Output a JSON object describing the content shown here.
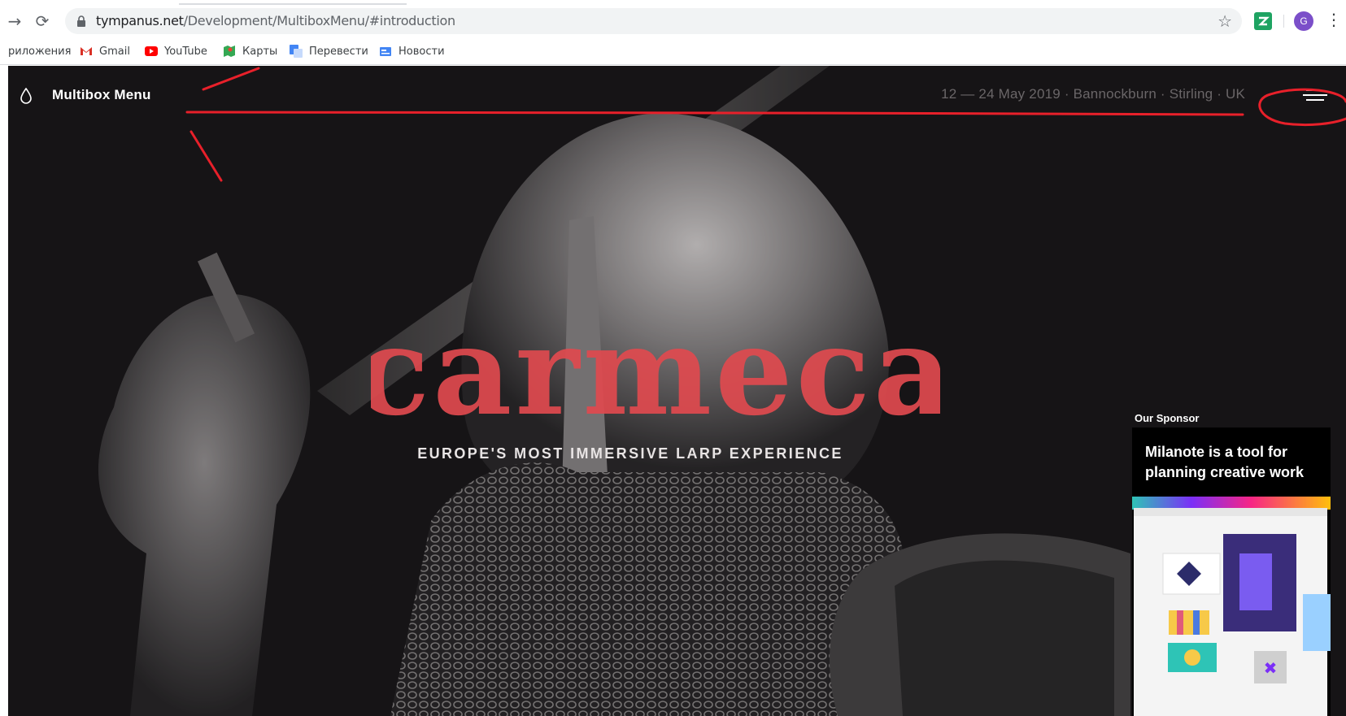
{
  "browser": {
    "url_host": "tympanus.net",
    "url_path": "/Development/MultiboxMenu/#introduction",
    "profile_initial": "G",
    "bookmarks": [
      {
        "label": "риложения",
        "icon": "apps-icon"
      },
      {
        "label": "Gmail",
        "icon": "gmail-icon"
      },
      {
        "label": "YouTube",
        "icon": "youtube-icon"
      },
      {
        "label": "Карты",
        "icon": "maps-icon"
      },
      {
        "label": "Перевести",
        "icon": "translate-icon"
      },
      {
        "label": "Новости",
        "icon": "news-icon"
      }
    ]
  },
  "site": {
    "name": "Multibox Menu",
    "event_info": "12 — 24 May 2019 · Bannockburn · Stirling · UK",
    "hero_title": "carmeca",
    "hero_subtitle": "EUROPE'S MOST IMMERSIVE LARP EXPERIENCE"
  },
  "sponsor": {
    "label": "Our Sponsor",
    "headline": "Milanote is a tool for planning creative work"
  },
  "colors": {
    "accent": "#e04a4f",
    "annotation": "#e8202a",
    "page_bg": "#1b191b"
  }
}
